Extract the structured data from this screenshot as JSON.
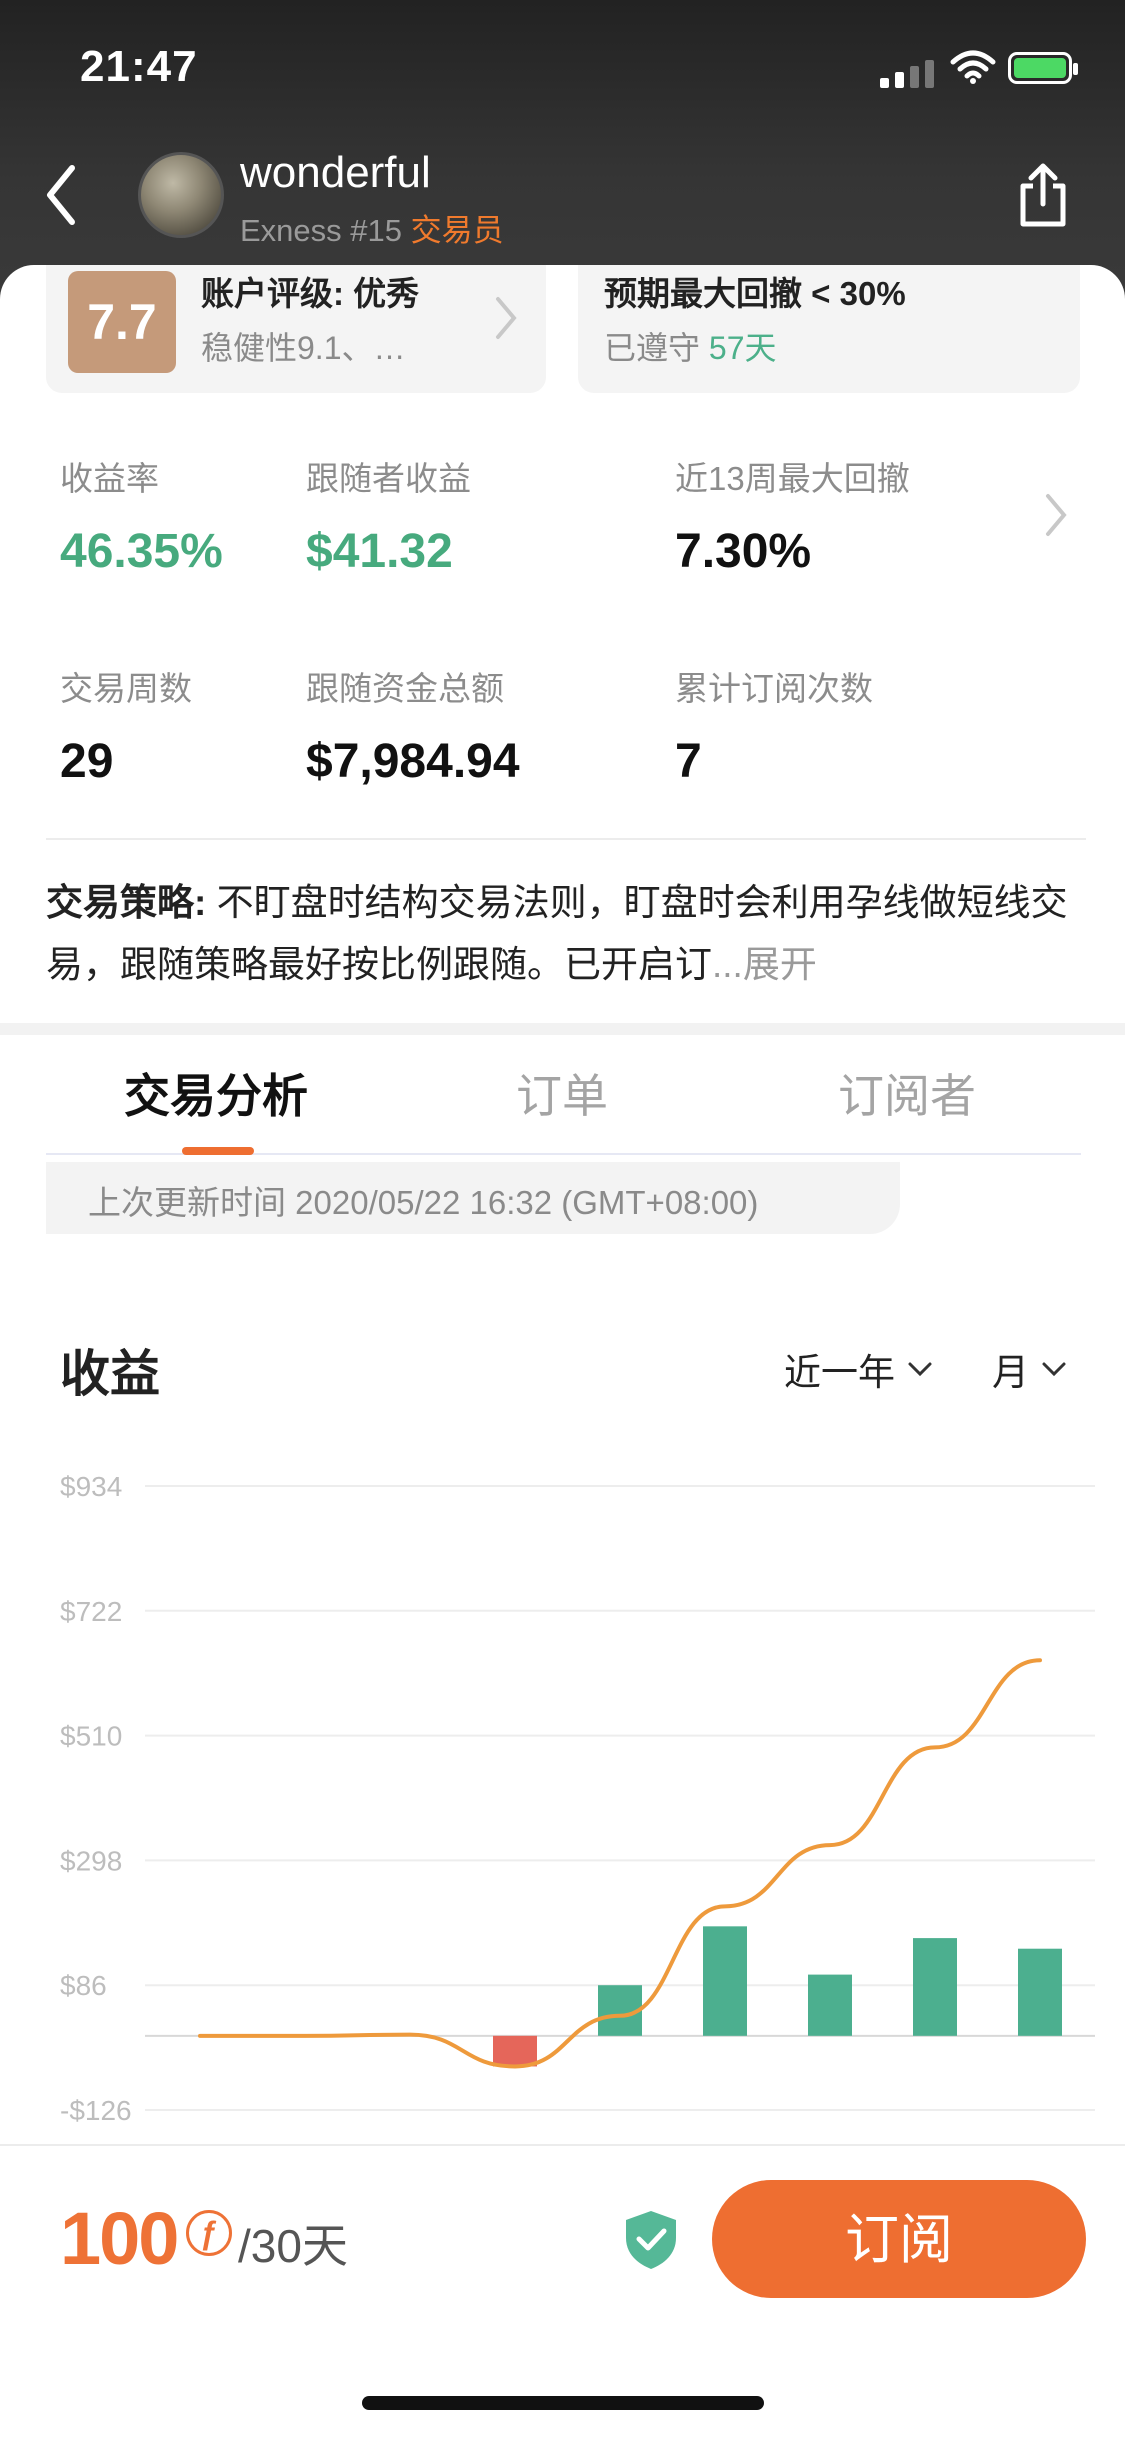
{
  "status_bar": {
    "time": "21:47"
  },
  "header": {
    "trader_name": "wonderful",
    "broker": "Exness #15",
    "role_badge": "交易员"
  },
  "cards": {
    "rating": {
      "score": "7.7",
      "title": "账户评级: 优秀",
      "subtitle": "稳健性9.1、…"
    },
    "drawdown": {
      "title": "预期最大回撤 < 30%",
      "subtitle_prefix": "已遵守",
      "days": "57天"
    }
  },
  "metrics": {
    "return_label": "收益率",
    "return_value": "46.35%",
    "follower_profit_label": "跟随者收益",
    "follower_profit_value": "$41.32",
    "max_drawdown_label": "近13周最大回撤",
    "max_drawdown_value": "7.30%",
    "weeks_label": "交易周数",
    "weeks_value": "29",
    "follow_funds_label": "跟随资金总额",
    "follow_funds_value": "$7,984.94",
    "subscriptions_label": "累计订阅次数",
    "subscriptions_value": "7"
  },
  "strategy": {
    "lead": "交易策略:",
    "text": " 不盯盘时结构交易法则，盯盘时会利用孕线做短线交易，跟随策略最好按比例跟随。已开启订",
    "more": "...展开"
  },
  "tabs": [
    {
      "label": "交易分析",
      "active": true
    },
    {
      "label": "订单",
      "active": false
    },
    {
      "label": "订阅者",
      "active": false
    }
  ],
  "update_time": "上次更新时间 2020/05/22 16:32 (GMT+08:00)",
  "profit_section": {
    "title": "收益",
    "range_filter": "近一年",
    "period_filter": "月"
  },
  "chart_data": {
    "type": "bar",
    "yticks": [
      "$934",
      "$722",
      "$510",
      "$298",
      "$86",
      "-$126"
    ],
    "ylim": [
      -126,
      934
    ],
    "categories": [
      "",
      "",
      "",
      "",
      "",
      "",
      "",
      "",
      ""
    ],
    "series": [
      {
        "values": [
          0,
          0,
          0,
          -52,
          86,
          186,
          104,
          166,
          148
        ]
      }
    ],
    "cumulative_line": [
      0,
      0,
      2,
      -52,
      34,
      220,
      324,
      490,
      638
    ],
    "colors": {
      "positive": "#4caf8f",
      "negative": "#e5665a",
      "line": "#ee9a3c"
    },
    "grid": true
  },
  "footer": {
    "price": "100",
    "coin_symbol": "ƒ",
    "period": "/30天",
    "subscribe_label": "订阅"
  }
}
